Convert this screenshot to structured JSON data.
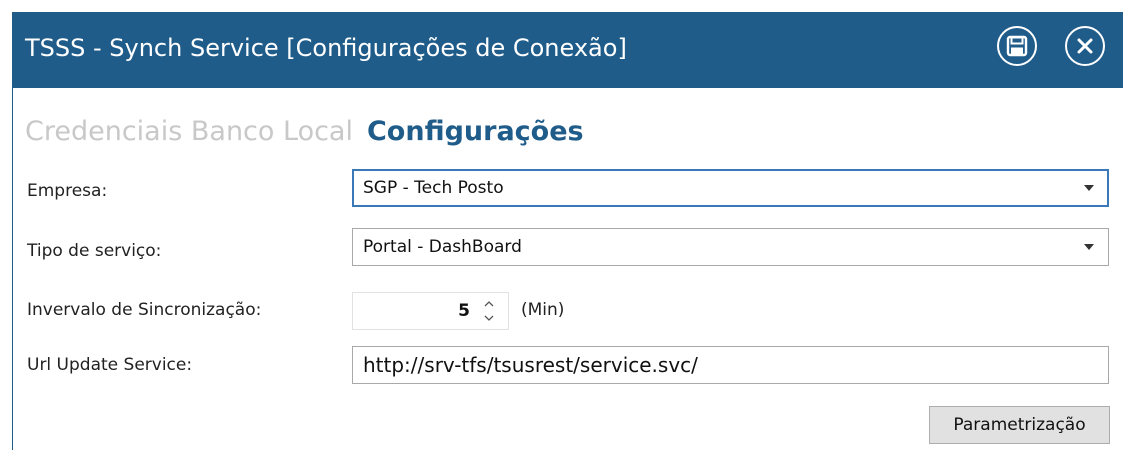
{
  "window": {
    "title": "TSSS - Synch Service [Configurações de Conexão]",
    "accent_color": "#1f5c8a",
    "title_icons": [
      "save-icon",
      "close-icon"
    ]
  },
  "tabs": [
    {
      "label": "Credenciais Banco Local",
      "active": false
    },
    {
      "label": "Configurações",
      "active": true
    }
  ],
  "form": {
    "empresa": {
      "label": "Empresa:",
      "value": "SGP - Tech Posto"
    },
    "tipo_servico": {
      "label": "Tipo de serviço:",
      "value": "Portal - DashBoard"
    },
    "intervalo": {
      "label": "Invervalo de Sincronização:",
      "value": "5",
      "unit": "(Min)"
    },
    "url": {
      "label": "Url Update Service:",
      "value": "http://srv-tfs/tsusrest/service.svc/"
    }
  },
  "buttons": {
    "parametrizacao": "Parametrização"
  }
}
